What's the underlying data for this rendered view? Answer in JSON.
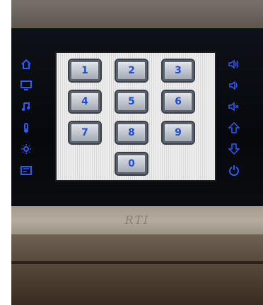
{
  "device": {
    "brand_logo": "RTI",
    "keypad": {
      "keys": [
        "1",
        "2",
        "3",
        "4",
        "5",
        "6",
        "7",
        "8",
        "9",
        "0"
      ]
    },
    "left_buttons": [
      {
        "name": "home-icon"
      },
      {
        "name": "tv-icon"
      },
      {
        "name": "music-icon"
      },
      {
        "name": "thermometer-icon"
      },
      {
        "name": "lighting-icon"
      },
      {
        "name": "media-icon"
      }
    ],
    "right_buttons": [
      {
        "name": "volume-up-icon"
      },
      {
        "name": "volume-down-icon"
      },
      {
        "name": "mute-icon"
      },
      {
        "name": "channel-up-icon"
      },
      {
        "name": "channel-down-icon"
      },
      {
        "name": "power-icon"
      }
    ],
    "accent_color": "#2a5cff",
    "key_text_color": "#1f4fd8"
  }
}
